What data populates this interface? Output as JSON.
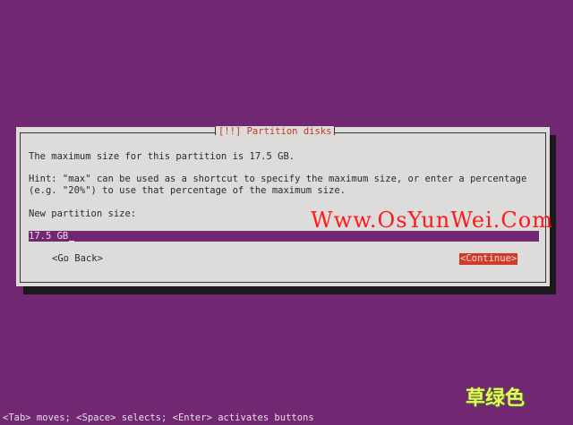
{
  "dialog": {
    "title": "[!!] Partition disks",
    "max_size_text": "The maximum size for this partition is 17.5 GB.",
    "hint_line1": "Hint: \"max\" can be used as a shortcut to specify the maximum size, or enter a percentage",
    "hint_line2": "(e.g. \"20%\") to use that percentage of the maximum size.",
    "field_label": "New partition size:",
    "field_value": "17.5 GB",
    "go_back_label": "<Go Back>",
    "continue_label": "<Continue>"
  },
  "watermark": "Www.OsYunWei.Com",
  "logo_text": "草绿色",
  "status_bar": "<Tab> moves; <Space> selects; <Enter> activates buttons",
  "colors": {
    "background": "#722772",
    "dialog_bg": "#dedbdb",
    "accent": "#d03c2a",
    "watermark": "#ff1a1a"
  }
}
